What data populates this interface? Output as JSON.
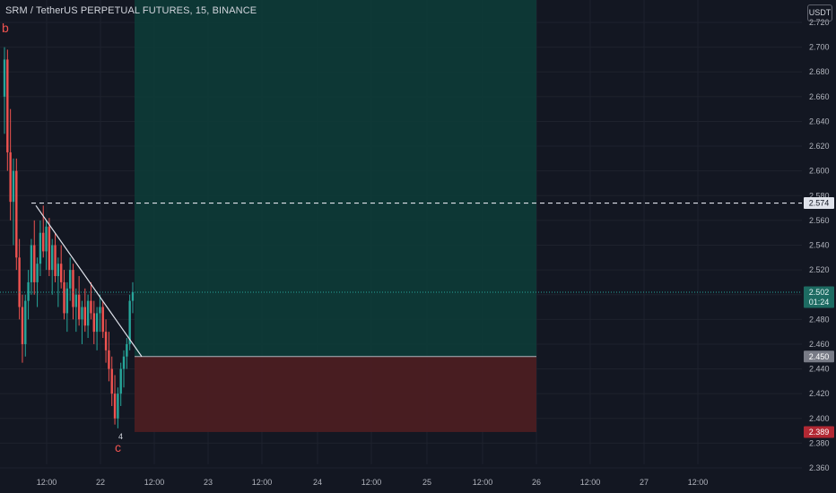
{
  "header": {
    "title": "SRM / TetherUS PERPETUAL FUTURES, 15, BINANCE",
    "currency_button": "USDT"
  },
  "colors": {
    "background": "#131722",
    "grid": "#1e222d",
    "up": "#26a69a",
    "down": "#ef5350",
    "target_zone": "#0d3b37",
    "stop_zone": "#4b1e22",
    "axis_text": "#b2b5be",
    "wave_label": "#ef5350"
  },
  "chart_data": {
    "type": "candlestick",
    "title": "SRM / TetherUS PERPETUAL FUTURES, 15, BINANCE",
    "y_axis": {
      "side": "right",
      "ylim": [
        2.36,
        2.725
      ],
      "ticks": [
        "2.720",
        "2.700",
        "2.680",
        "2.660",
        "2.640",
        "2.620",
        "2.600",
        "2.580",
        "2.560",
        "2.540",
        "2.520",
        "2.500",
        "2.480",
        "2.460",
        "2.440",
        "2.420",
        "2.400",
        "2.380",
        "2.360"
      ]
    },
    "x_axis": {
      "ticks": [
        "12:00",
        "22",
        "12:00",
        "23",
        "12:00",
        "24",
        "12:00",
        "25",
        "12:00",
        "26",
        "12:00",
        "27",
        "12:00"
      ]
    },
    "grid": true,
    "price_labels": [
      {
        "id": "resistance",
        "value": 2.574,
        "text": "2.574",
        "style": "dashed-line"
      },
      {
        "id": "last",
        "value": 2.502,
        "text": "2.502",
        "sub": "01:24",
        "style": "last-price"
      },
      {
        "id": "entry",
        "value": 2.45,
        "text": "2.450",
        "style": "entry"
      },
      {
        "id": "stop",
        "value": 2.389,
        "text": "2.389",
        "style": "stop"
      }
    ],
    "position": {
      "entry": 2.45,
      "target": 2.725,
      "stop": 2.389,
      "start_x": "21 12:00",
      "end_x": "26"
    },
    "wave_labels": [
      {
        "text": "b",
        "near": "2.72"
      },
      {
        "text": "c",
        "near": "2.38"
      },
      {
        "text": "4",
        "near": "2.393"
      }
    ],
    "trendline": {
      "from": {
        "x": "21 13:00",
        "y": 2.572
      },
      "to": {
        "x": "22 15:00",
        "y": 2.45
      }
    },
    "candles": [
      [
        2.66,
        2.7,
        2.63,
        2.69
      ],
      [
        2.69,
        2.698,
        2.6,
        2.615
      ],
      [
        2.615,
        2.65,
        2.56,
        2.575
      ],
      [
        2.575,
        2.61,
        2.54,
        2.6
      ],
      [
        2.6,
        2.61,
        2.52,
        2.53
      ],
      [
        2.53,
        2.545,
        2.48,
        2.49
      ],
      [
        2.49,
        2.5,
        2.445,
        2.46
      ],
      [
        2.46,
        2.5,
        2.45,
        2.495
      ],
      [
        2.495,
        2.52,
        2.48,
        2.51
      ],
      [
        2.51,
        2.545,
        2.5,
        2.54
      ],
      [
        2.54,
        2.56,
        2.5,
        2.51
      ],
      [
        2.51,
        2.53,
        2.49,
        2.525
      ],
      [
        2.525,
        2.56,
        2.515,
        2.55
      ],
      [
        2.55,
        2.572,
        2.53,
        2.535
      ],
      [
        2.535,
        2.56,
        2.52,
        2.555
      ],
      [
        2.555,
        2.562,
        2.515,
        2.52
      ],
      [
        2.52,
        2.545,
        2.5,
        2.54
      ],
      [
        2.54,
        2.55,
        2.51,
        2.515
      ],
      [
        2.515,
        2.53,
        2.49,
        2.525
      ],
      [
        2.525,
        2.54,
        2.505,
        2.51
      ],
      [
        2.51,
        2.52,
        2.48,
        2.485
      ],
      [
        2.485,
        2.51,
        2.47,
        2.505
      ],
      [
        2.505,
        2.53,
        2.495,
        2.52
      ],
      [
        2.52,
        2.525,
        2.48,
        2.49
      ],
      [
        2.49,
        2.505,
        2.47,
        2.5
      ],
      [
        2.5,
        2.515,
        2.475,
        2.48
      ],
      [
        2.48,
        2.495,
        2.46,
        2.49
      ],
      [
        2.49,
        2.505,
        2.47,
        2.475
      ],
      [
        2.475,
        2.5,
        2.465,
        2.495
      ],
      [
        2.495,
        2.51,
        2.48,
        2.485
      ],
      [
        2.485,
        2.495,
        2.46,
        2.47
      ],
      [
        2.47,
        2.49,
        2.455,
        2.485
      ],
      [
        2.485,
        2.5,
        2.47,
        2.49
      ],
      [
        2.49,
        2.495,
        2.465,
        2.47
      ],
      [
        2.47,
        2.48,
        2.445,
        2.455
      ],
      [
        2.455,
        2.47,
        2.43,
        2.44
      ],
      [
        2.44,
        2.45,
        2.41,
        2.42
      ],
      [
        2.42,
        2.435,
        2.395,
        2.4
      ],
      [
        2.4,
        2.425,
        2.392,
        2.42
      ],
      [
        2.42,
        2.445,
        2.41,
        2.44
      ],
      [
        2.44,
        2.455,
        2.425,
        2.45
      ],
      [
        2.45,
        2.465,
        2.44,
        2.46
      ],
      [
        2.46,
        2.5,
        2.455,
        2.495
      ],
      [
        2.495,
        2.51,
        2.485,
        2.502
      ]
    ]
  }
}
